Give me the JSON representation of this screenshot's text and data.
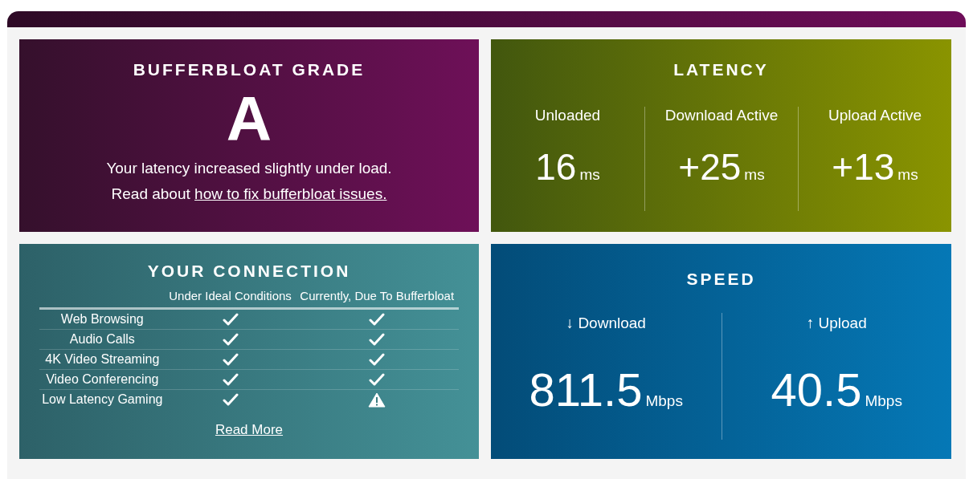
{
  "grade": {
    "title": "BUFFERBLOAT GRADE",
    "letter": "A",
    "message": "Your latency increased slightly under load.",
    "read_prefix": "Read about",
    "link": "how to fix bufferbloat issues."
  },
  "latency": {
    "title": "LATENCY",
    "columns": [
      {
        "label": "Unloaded",
        "value": "16",
        "unit": "ms"
      },
      {
        "label": "Download Active",
        "value": "+25",
        "unit": "ms"
      },
      {
        "label": "Upload Active",
        "value": "+13",
        "unit": "ms"
      }
    ]
  },
  "connection": {
    "title": "YOUR CONNECTION",
    "columns": [
      "Under Ideal Conditions",
      "Currently, Due To Bufferbloat"
    ],
    "rows": [
      {
        "label": "Web Browsing",
        "ideal_ok": true,
        "current_ok": true
      },
      {
        "label": "Audio Calls",
        "ideal_ok": true,
        "current_ok": true
      },
      {
        "label": "4K Video Streaming",
        "ideal_ok": true,
        "current_ok": true
      },
      {
        "label": "Video Conferencing",
        "ideal_ok": true,
        "current_ok": true
      },
      {
        "label": "Low Latency Gaming",
        "ideal_ok": true,
        "current_ok": false
      }
    ],
    "link": "Read More"
  },
  "speed": {
    "title": "SPEED",
    "columns": [
      {
        "label": "↓ Download",
        "value": "811.5",
        "unit": "Mbps"
      },
      {
        "label": "↑ Upload",
        "value": "40.5",
        "unit": "Mbps"
      }
    ]
  }
}
